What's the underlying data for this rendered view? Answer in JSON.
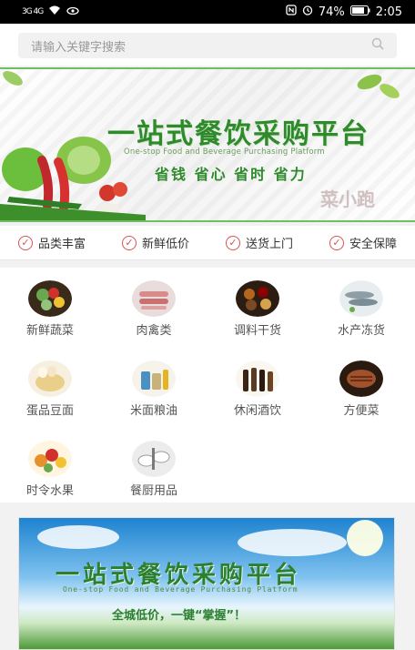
{
  "status": {
    "left_text": "3G 4G",
    "battery": "74%",
    "time": "2:05"
  },
  "search": {
    "placeholder": "请输入关键字搜索"
  },
  "banner1": {
    "title": "一站式餐饮采购平台",
    "subtitle": "One-stop Food and Beverage Purchasing Platform",
    "slogan": "省钱  省心  省时  省力",
    "stamp_text": "菜小跑"
  },
  "features": [
    {
      "label": "品类丰富"
    },
    {
      "label": "新鲜低价"
    },
    {
      "label": "送货上门"
    },
    {
      "label": "安全保障"
    }
  ],
  "categories": [
    {
      "label": "新鲜蔬菜",
      "icon": "vegetables-icon",
      "color": "#6aa84f"
    },
    {
      "label": "肉禽类",
      "icon": "meat-icon",
      "color": "#d98b8b"
    },
    {
      "label": "调料干货",
      "icon": "spices-icon",
      "color": "#8b5a2b"
    },
    {
      "label": "水产冻货",
      "icon": "fish-icon",
      "color": "#9aa8b0"
    },
    {
      "label": "蛋品豆面",
      "icon": "eggs-icon",
      "color": "#e9cf8a"
    },
    {
      "label": "米面粮油",
      "icon": "rice-oil-icon",
      "color": "#c8b27a"
    },
    {
      "label": "休闲酒饮",
      "icon": "wine-icon",
      "color": "#5a3b24"
    },
    {
      "label": "方便菜",
      "icon": "steak-icon",
      "color": "#a0522d"
    },
    {
      "label": "时令水果",
      "icon": "fruit-icon",
      "color": "#e6912c"
    },
    {
      "label": "餐厨用品",
      "icon": "tableware-icon",
      "color": "#7a7a7a"
    }
  ],
  "banner2": {
    "title": "一站式餐饮采购平台",
    "subtitle": "One-stop Food and Beverage Purchasing Platform",
    "slogan": "全城低价，一键“掌握”！"
  },
  "colors": {
    "accent_green": "#2f8a2c",
    "check_red": "#d9534f"
  }
}
